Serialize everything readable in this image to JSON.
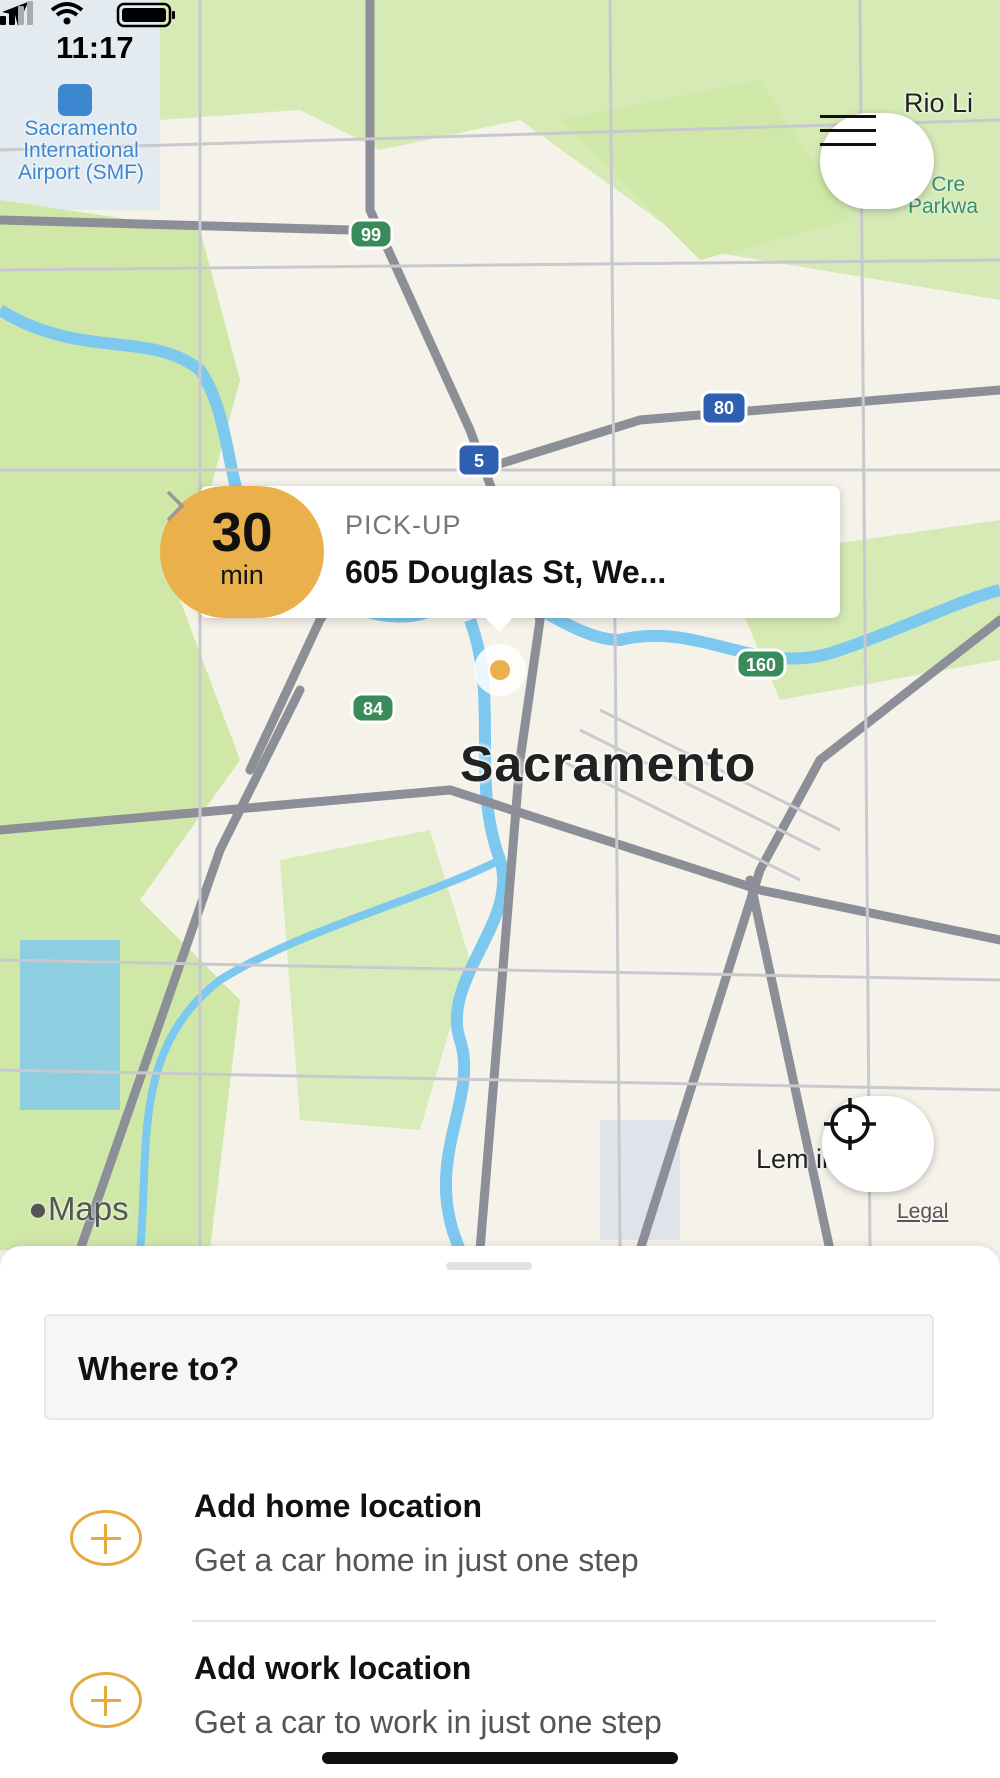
{
  "status_bar": {
    "time": "11:17"
  },
  "map": {
    "airport_label": "Sacramento International Airport (SMF)",
    "city_label": "Sacramento",
    "place_rio_linda": "Rio Li",
    "place_parkway": "ry Cre Parkwa",
    "place_lemon_hill": "Lem ill",
    "highway_shields": [
      "99",
      "80",
      "5",
      "160",
      "84"
    ],
    "attribution": "Maps",
    "legal": "Legal",
    "pin_color": "#e9b04c"
  },
  "pickup_card": {
    "eta_value": "30",
    "eta_unit": "min",
    "label": "PICK-UP",
    "address": "605 Douglas St, We..."
  },
  "sheet": {
    "search_placeholder": "Where to?",
    "items": [
      {
        "title": "Add home location",
        "subtitle": "Get a car home in just one step"
      },
      {
        "title": "Add work location",
        "subtitle": "Get a car to work in just one step"
      }
    ]
  },
  "colors": {
    "accent": "#e5ab41",
    "eta_bg": "#e9b04c",
    "water": "#7cc8ef",
    "park": "#cfe8a8"
  }
}
